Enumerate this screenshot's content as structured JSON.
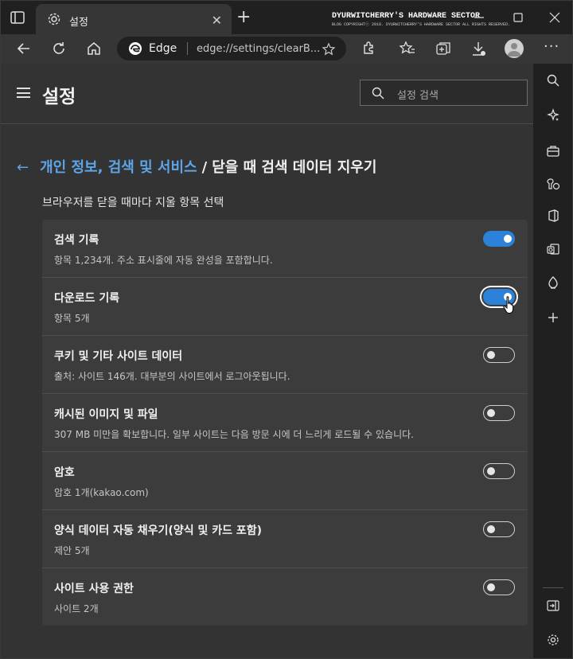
{
  "window": {
    "brand_title": "DYURWITCHERRY'S HARDWARE SECTOR",
    "brand_sub": "BLOG COPYRIGHTⓒ 2018. DYURWITCHERRY'S HARDWARE SECTOR ALL RIGHTS RESERVED."
  },
  "tab": {
    "title": "설정",
    "close_glyph": "✕"
  },
  "toolbar": {
    "omni_label": "Edge",
    "url": "edge://settings/clearB...",
    "more_glyph": "···"
  },
  "header": {
    "title": "설정",
    "search_placeholder": "설정 검색"
  },
  "breadcrumb": {
    "back_glyph": "←",
    "parent": "개인 정보, 검색 및 서비스",
    "separator": "/",
    "current": "닫을 때 검색 데이터 지우기"
  },
  "subtitle": "브라우저를 닫을 때마다 지울 항목 선택",
  "items": [
    {
      "name": "검색 기록",
      "desc": "항목 1,234개. 주소 표시줄에 자동 완성을 포함합니다.",
      "enabled": true
    },
    {
      "name": "다운로드 기록",
      "desc": "항목 5개",
      "enabled": true
    },
    {
      "name": "쿠키 및 기타 사이트 데이터",
      "desc": "출처: 사이트 146개. 대부분의 사이트에서 로그아웃됩니다.",
      "enabled": false
    },
    {
      "name": "캐시된 이미지 및 파일",
      "desc": "307 MB 미만을 확보합니다. 일부 사이트는 다음 방문 시에 더 느리게 로드될 수 있습니다.",
      "enabled": false
    },
    {
      "name": "암호",
      "desc": "암호 1개(kakao.com)",
      "enabled": false
    },
    {
      "name": "양식 데이터 자동 채우기(양식 및 카드 포함)",
      "desc": "제안 5개",
      "enabled": false
    },
    {
      "name": "사이트 사용 권한",
      "desc": "사이트 2개",
      "enabled": false
    }
  ],
  "colors": {
    "accent": "#2b82d8",
    "link": "#5ea5e8",
    "page_bg": "#333333",
    "card_bg": "#3c3c3c"
  },
  "icons": {
    "tabbar": [
      "tab-actions-icon",
      "gear-icon",
      "close-icon",
      "new-tab-icon"
    ],
    "window": [
      "minimize-icon",
      "maximize-icon",
      "close-window-icon"
    ],
    "toolbar": [
      "back-icon",
      "refresh-icon",
      "home-icon",
      "edge-logo-icon",
      "add-favorite-icon",
      "extensions-icon",
      "favorites-icon",
      "collections-icon",
      "downloads-icon",
      "profile-avatar",
      "more-icon"
    ],
    "sidebar": [
      "search-icon",
      "copilot-icon",
      "tools-icon",
      "games-icon",
      "office-icon",
      "outlook-icon",
      "drop-icon",
      "add-icon",
      "hide-sidebar-icon",
      "sidebar-settings-icon"
    ]
  }
}
